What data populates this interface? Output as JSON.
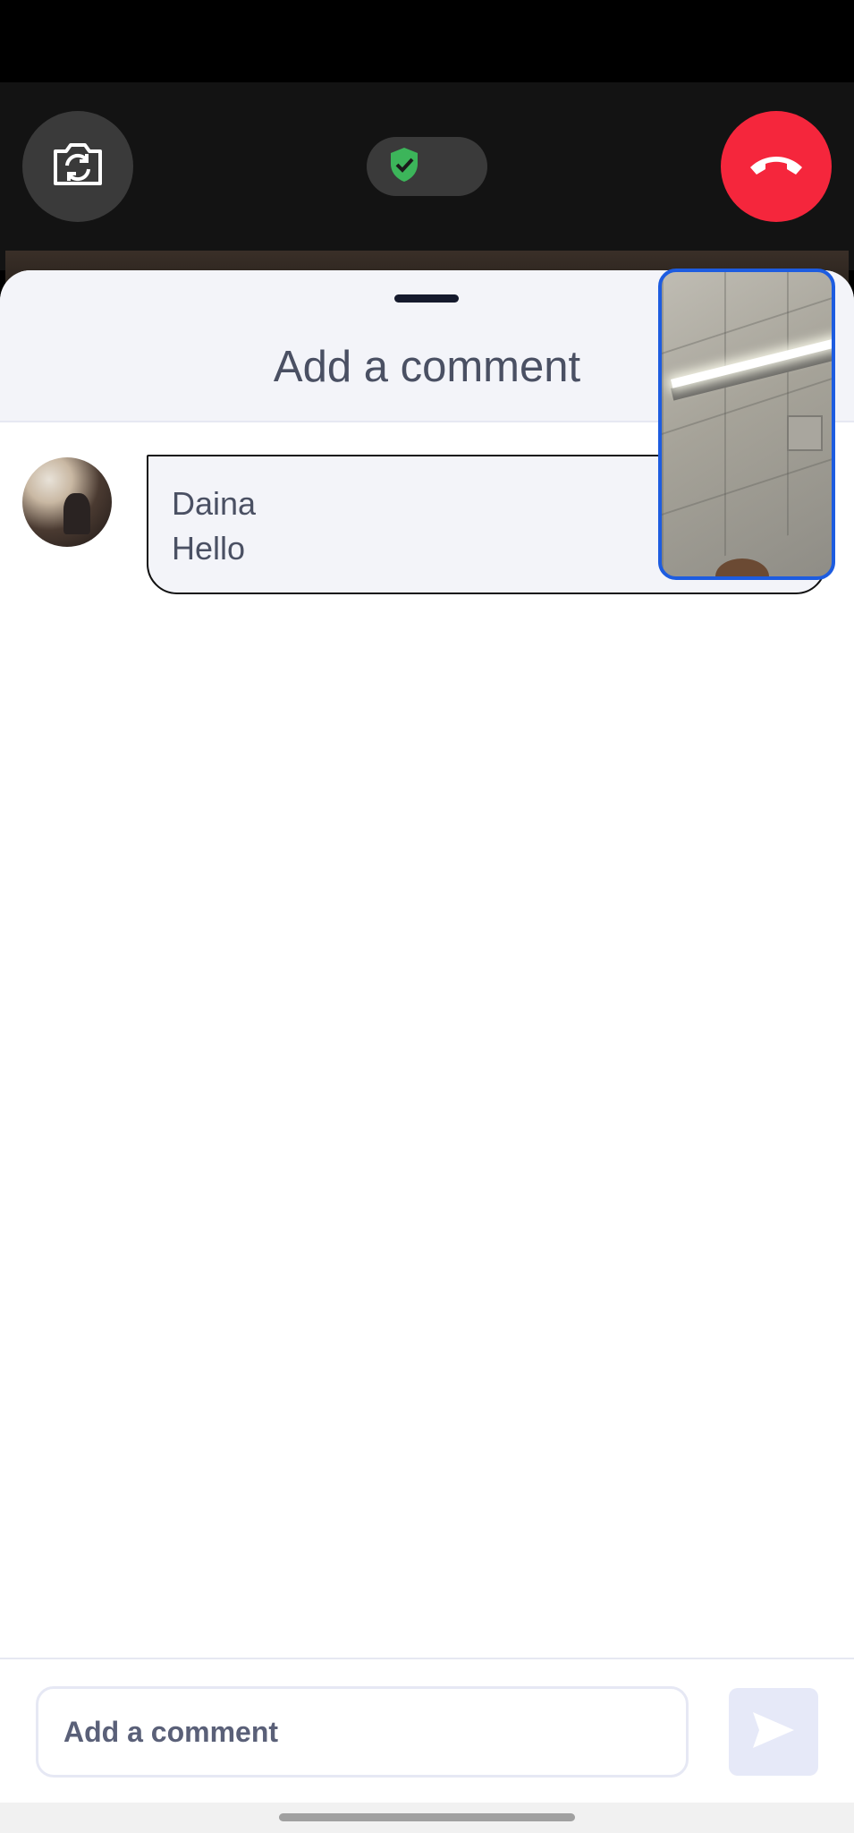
{
  "call": {
    "flip_camera_icon": "camera-flip-icon",
    "secure_icon": "shield-check-icon",
    "end_call_icon": "phone-hangup-icon",
    "colors": {
      "end_call": "#f5263c",
      "secure": "#3cb55a"
    }
  },
  "sheet": {
    "title": "Add a comment"
  },
  "comments": [
    {
      "author": "Daina",
      "text": "Hello"
    }
  ],
  "composer": {
    "placeholder": "Add a comment",
    "value": "",
    "send_icon": "send-icon"
  },
  "pip": {
    "border_color": "#1d5ce0"
  }
}
